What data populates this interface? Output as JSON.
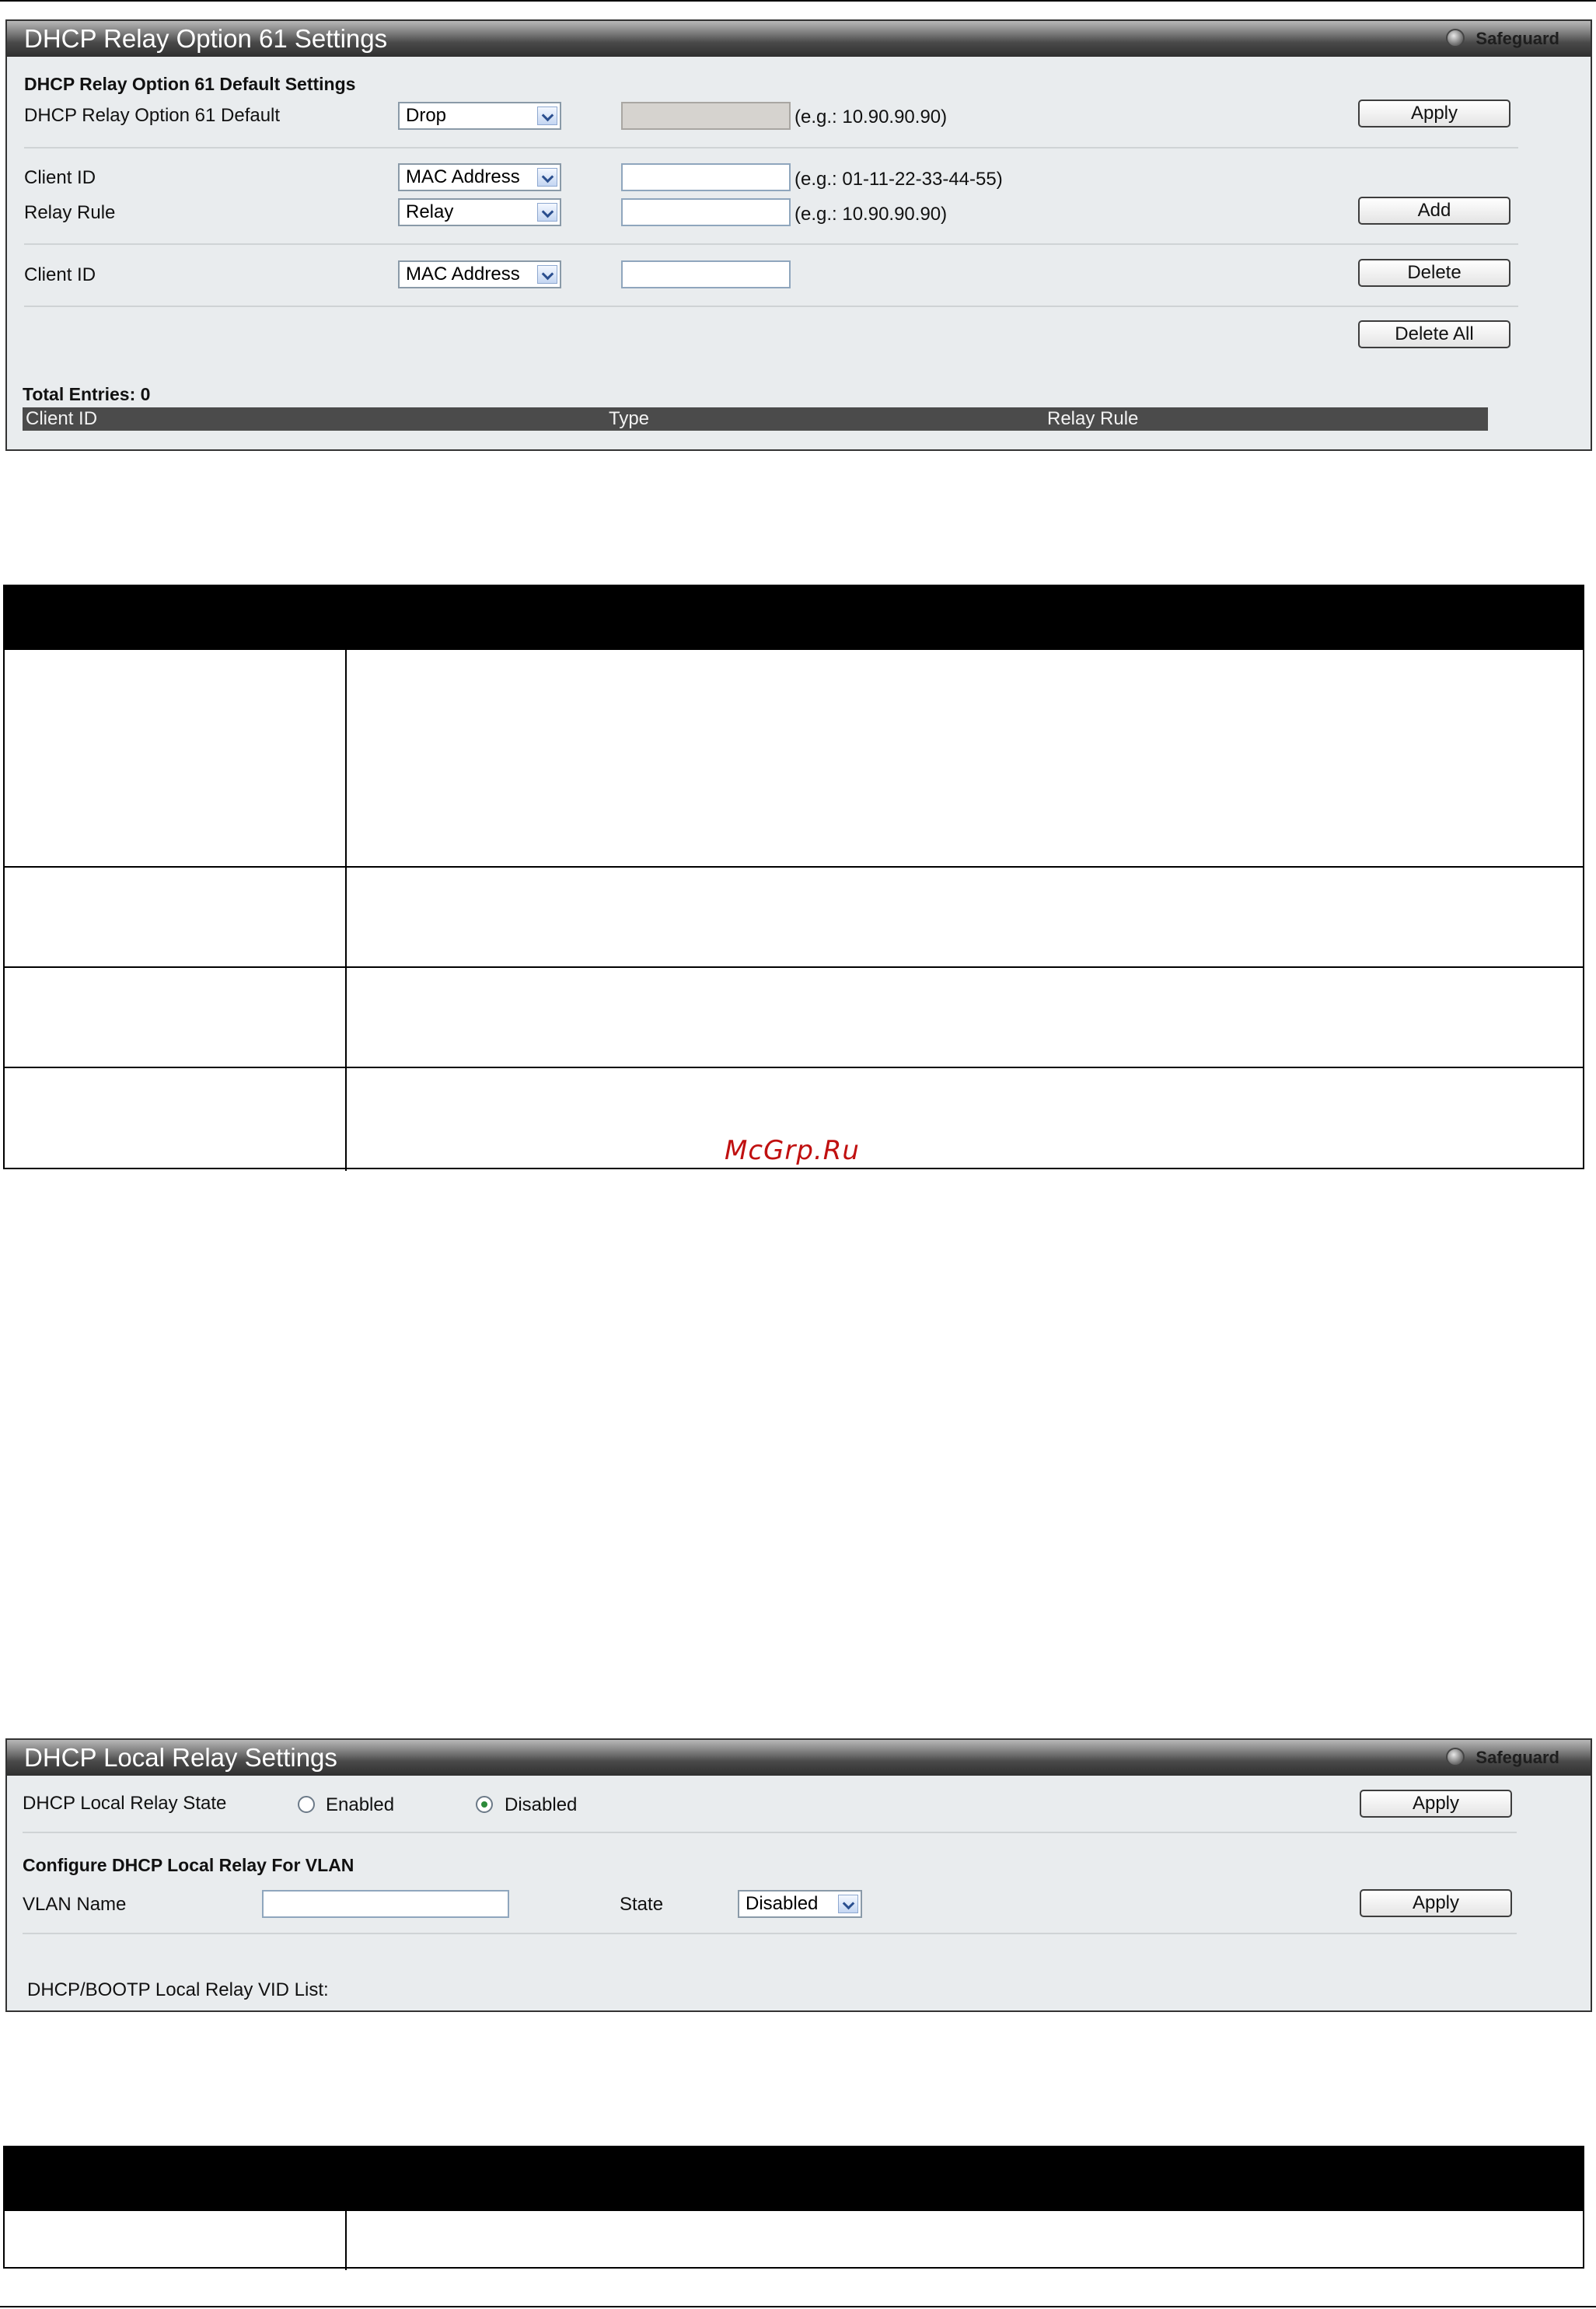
{
  "option61": {
    "title": "DHCP Relay Option 61 Settings",
    "safeguard": "Safeguard",
    "section_header": "DHCP Relay Option 61 Default Settings",
    "default_label": "DHCP Relay Option 61 Default",
    "default_select": "Drop",
    "default_hint": "(e.g.: 10.90.90.90)",
    "apply_label": "Apply",
    "client_id_label": "Client ID",
    "client_id_select": "MAC Address",
    "client_id_hint": "(e.g.: 01-11-22-33-44-55)",
    "relay_rule_label": "Relay Rule",
    "relay_rule_select": "Relay",
    "relay_rule_hint": "(e.g.: 10.90.90.90)",
    "add_label": "Add",
    "delete_client_id_label": "Client ID",
    "delete_client_id_select": "MAC Address",
    "delete_label": "Delete",
    "delete_all_label": "Delete All",
    "total_entries": "Total Entries: 0",
    "columns": [
      "Client ID",
      "Type",
      "Relay Rule"
    ]
  },
  "local_relay": {
    "title": "DHCP Local Relay Settings",
    "safeguard": "Safeguard",
    "state_label": "DHCP Local Relay State",
    "enabled_label": "Enabled",
    "disabled_label": "Disabled",
    "selected_state": "Disabled",
    "apply_label": "Apply",
    "section_header": "Configure DHCP Local Relay For VLAN",
    "vlan_name_label": "VLAN Name",
    "vlan_name_value": "",
    "state_field_label": "State",
    "state_select": "Disabled",
    "apply2_label": "Apply",
    "vid_list_label": "DHCP/BOOTP Local Relay VID List:"
  },
  "watermark": "McGrp.Ru",
  "colors": {
    "title_bar_dark": "#2f2f2f",
    "panel_bg": "#e9ecee",
    "table_header": "#4b4b4b",
    "watermark": "#c01010"
  }
}
